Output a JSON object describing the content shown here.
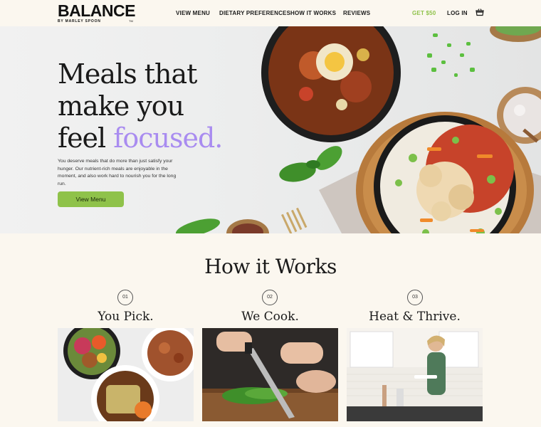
{
  "brand": {
    "name": "BALANCE",
    "tagline": "BY MARLEY SPOON",
    "tm": "TM"
  },
  "nav": {
    "items": [
      "VIEW MENU",
      "DIETARY PREFERENCES",
      "HOW IT WORKS",
      "REVIEWS"
    ],
    "promo": "GET $50",
    "login": "LOG IN",
    "cart_icon": "basket-icon"
  },
  "hero": {
    "title_line1": "Meals that",
    "title_line2": "make you",
    "title_line3_pre": "feel ",
    "title_line3_accent": "focused.",
    "description": "You deserve meals that do more than just satisfy your hunger. Our nutrient-rich meals are enjoyable in the moment, and also work hard to nourish you for the long run.",
    "cta": "View Menu"
  },
  "how_it_works": {
    "title": "How it Works",
    "steps": [
      {
        "num": "01",
        "title": "You Pick."
      },
      {
        "num": "02",
        "title": "We Cook."
      },
      {
        "num": "03",
        "title": "Heat & Thrive."
      }
    ]
  },
  "colors": {
    "accent_green": "#8fc24a",
    "accent_purple": "#a98cf0",
    "background": "#fbf7ef"
  }
}
